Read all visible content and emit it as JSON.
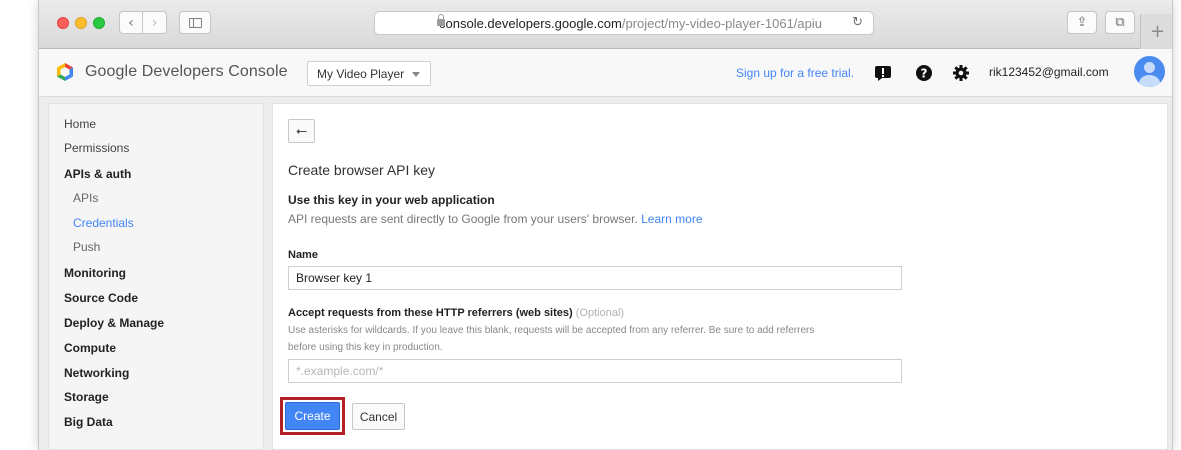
{
  "browser": {
    "url_domain": "console.developers.google.com",
    "url_path": "/project/my-video-player-1061/apiu",
    "back_glyph": "‹",
    "forward_glyph": "›",
    "reload_glyph": "↻",
    "share_glyph": "⇪",
    "tabs_glyph": "⧉",
    "newtab_glyph": "+"
  },
  "header": {
    "brand": "Google Developers Console",
    "project": "My Video Player",
    "trial_link": "Sign up for a free trial.",
    "email": "rik123452@gmail.com"
  },
  "sidebar": {
    "items": [
      {
        "label": "Home"
      },
      {
        "label": "Permissions"
      },
      {
        "label": "APIs & auth"
      },
      {
        "label": "APIs"
      },
      {
        "label": "Credentials"
      },
      {
        "label": "Push"
      },
      {
        "label": "Monitoring"
      },
      {
        "label": "Source Code"
      },
      {
        "label": "Deploy & Manage"
      },
      {
        "label": "Compute"
      },
      {
        "label": "Networking"
      },
      {
        "label": "Storage"
      },
      {
        "label": "Big Data"
      }
    ]
  },
  "main": {
    "back_glyph": "⭠",
    "title": "Create browser API key",
    "subhead": "Use this key in your web application",
    "description": "API requests are sent directly to Google from your users' browser.",
    "learn_more": "Learn more",
    "name_label": "Name",
    "name_value": "Browser key 1",
    "referrers_label": "Accept requests from these HTTP referrers (web sites)",
    "referrers_optional": "(Optional)",
    "referrers_help_line1": "Use asterisks for wildcards. If you leave this blank, requests will be accepted from any referrer. Be sure to add referrers",
    "referrers_help_line2": "before using this key in production.",
    "referrers_placeholder": "*.example.com/*",
    "create_label": "Create",
    "cancel_label": "Cancel"
  },
  "colors": {
    "accent": "#4285f4",
    "highlight_box": "#b21f24"
  }
}
